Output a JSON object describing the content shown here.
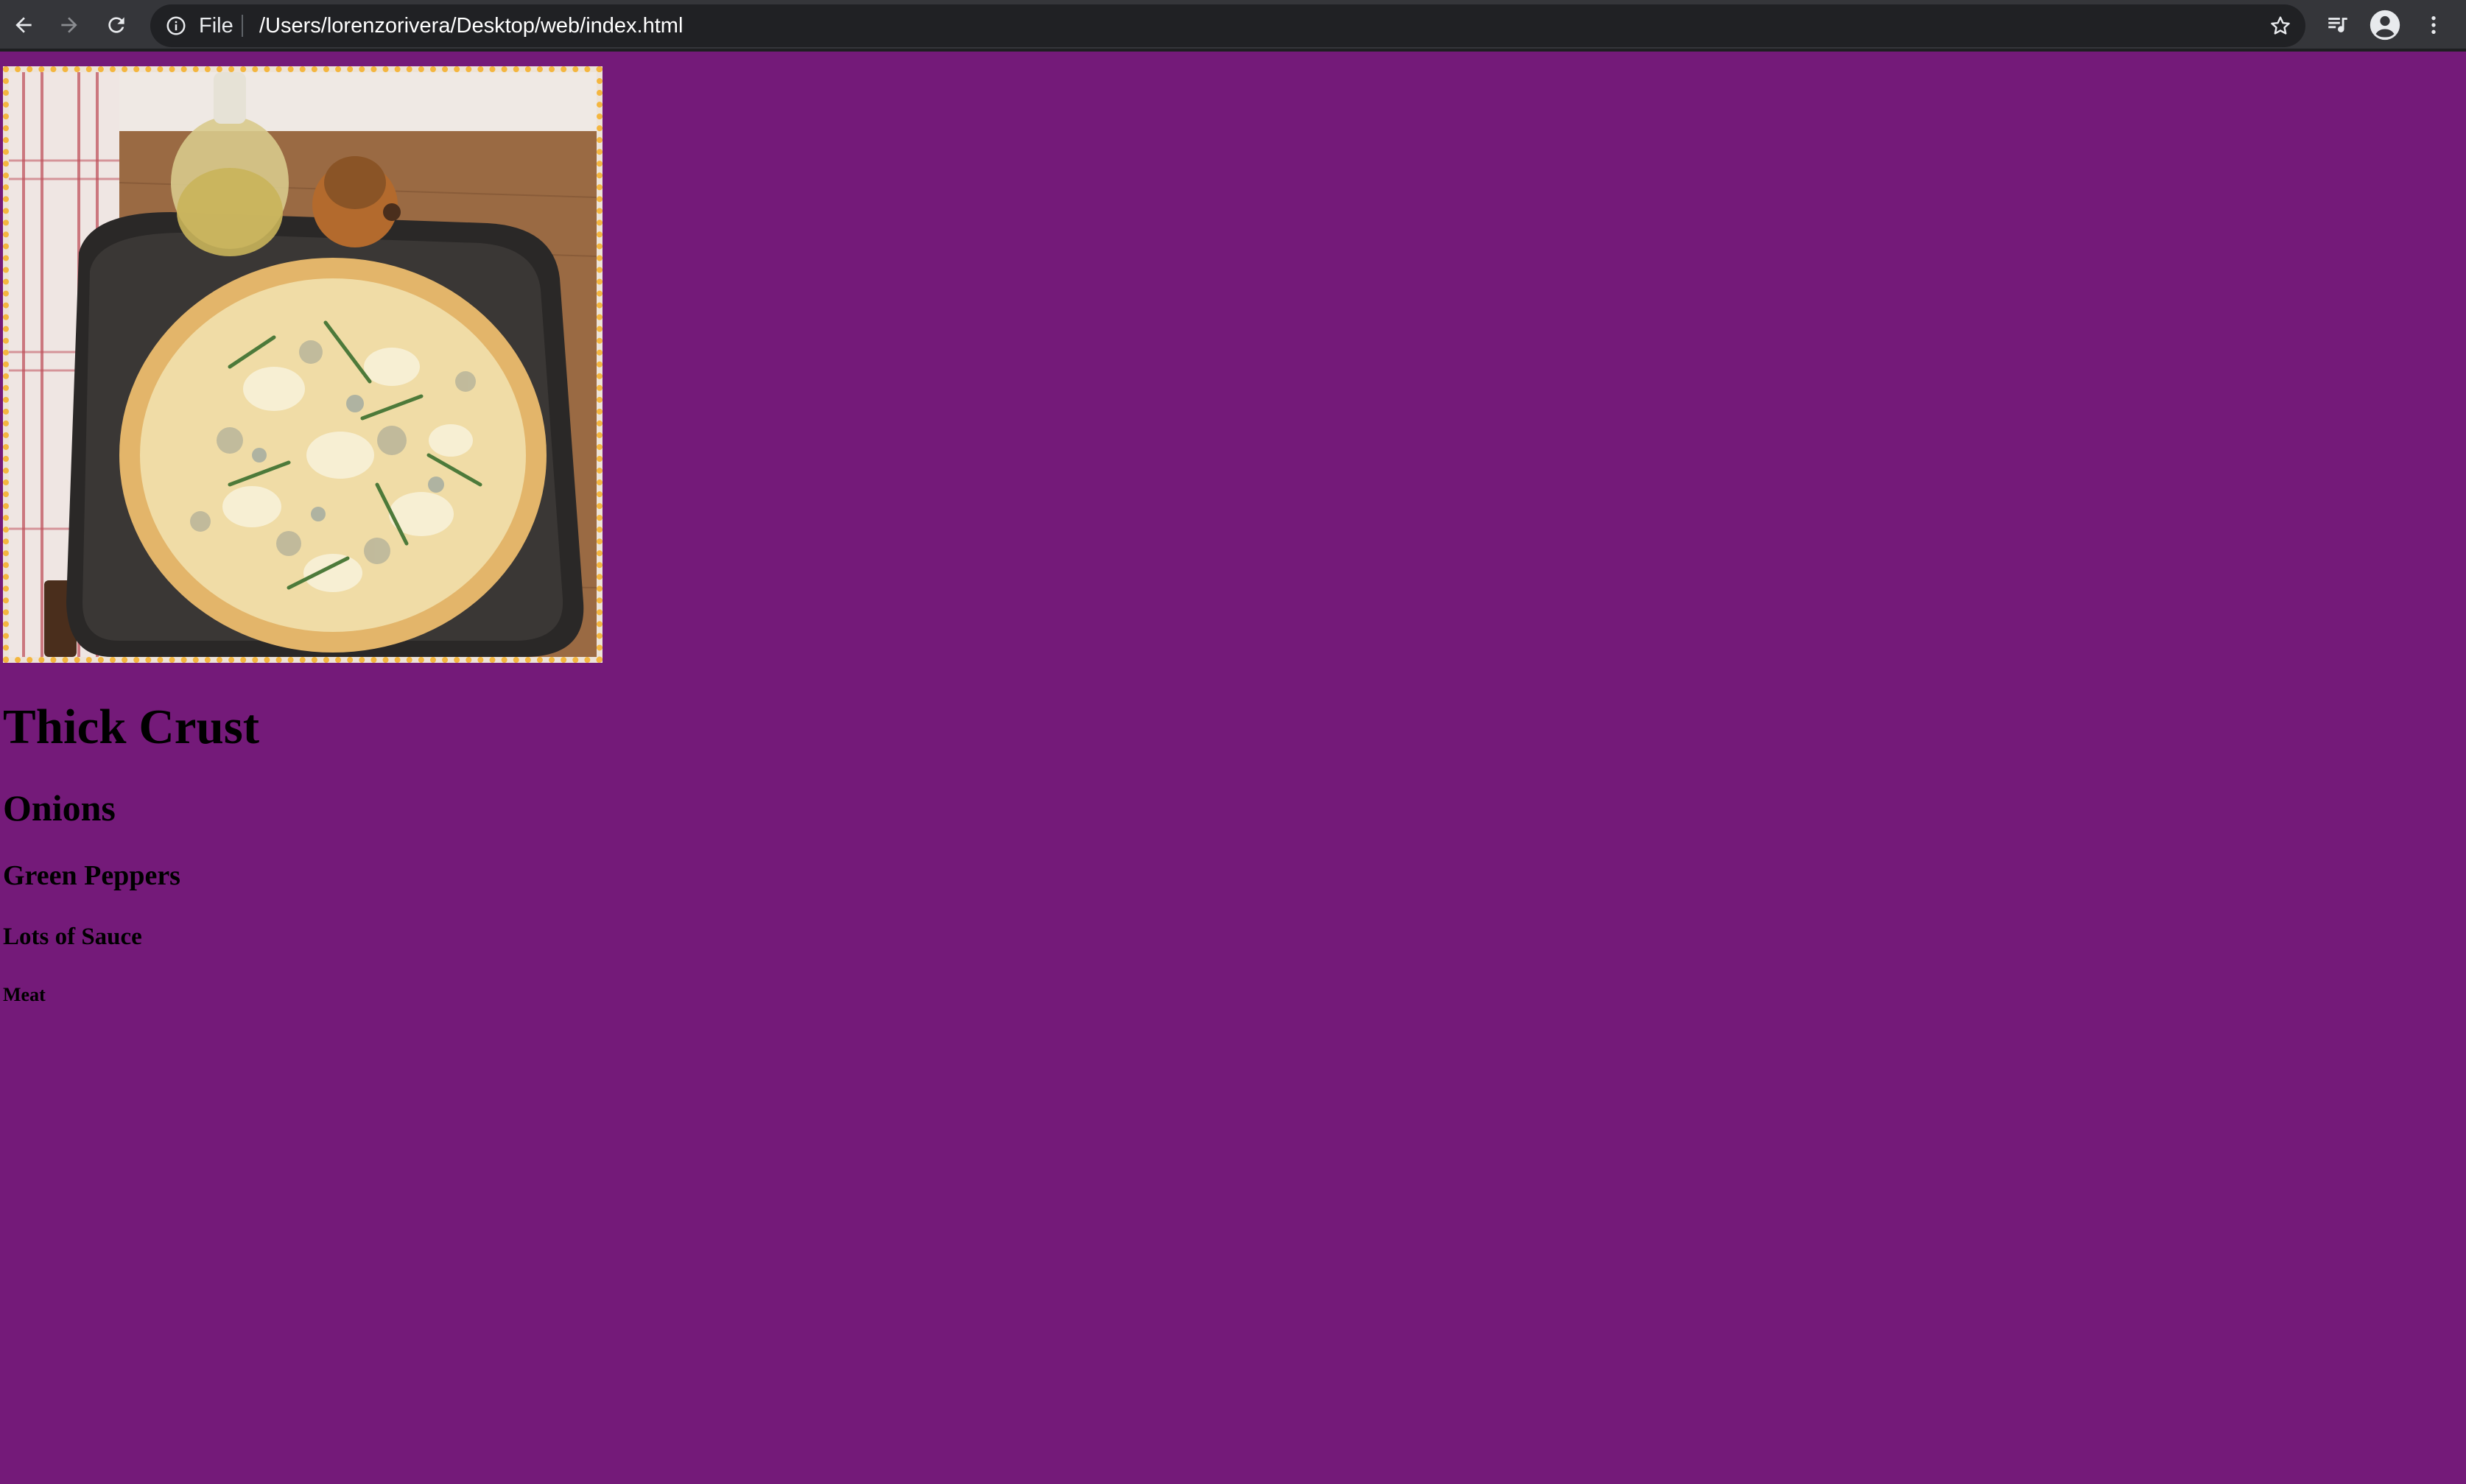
{
  "browser": {
    "scheme_label": "File",
    "url": "/Users/lorenzorivera/Desktop/web/index.html",
    "icons": {
      "back": "arrow-back-icon",
      "forward": "arrow-forward-icon",
      "reload": "reload-icon",
      "info": "info-icon",
      "bookmark": "star-icon",
      "media": "media-queue-icon",
      "profile": "account-circle-icon",
      "menu": "kebab-menu-icon"
    }
  },
  "page": {
    "background_color": "#741a79",
    "image": {
      "subject": "pizza",
      "border_color": "#f4b63f",
      "border_style": "dotted"
    },
    "headings": {
      "h1": "Thick Crust",
      "h2": "Onions",
      "h3": "Green Peppers",
      "h4": "Lots of Sauce",
      "h5": "Meat"
    }
  }
}
